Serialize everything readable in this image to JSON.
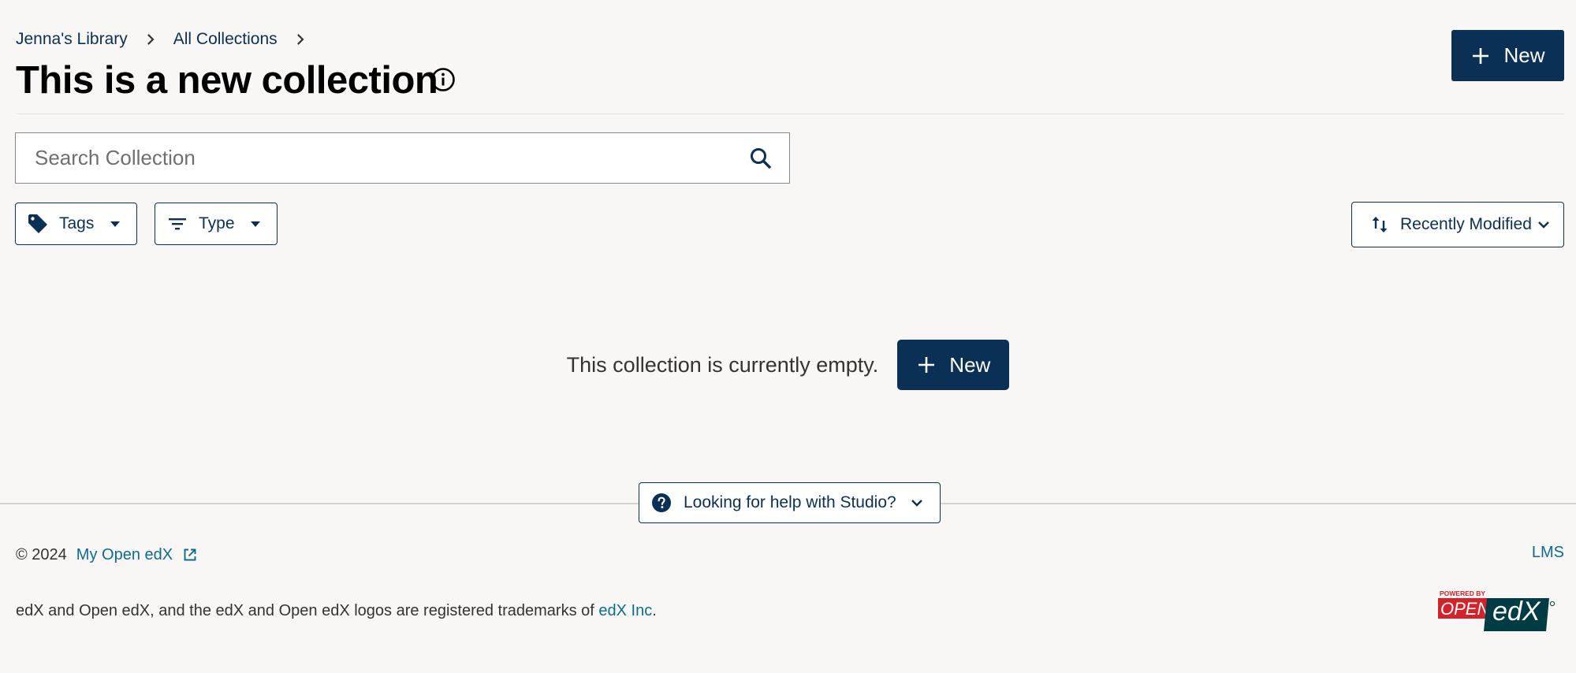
{
  "breadcrumb": {
    "items": [
      {
        "label": "Jenna's Library"
      },
      {
        "label": "All Collections"
      }
    ]
  },
  "header": {
    "title": "This is a new collection",
    "new_button_label": "New"
  },
  "search": {
    "placeholder": "Search Collection"
  },
  "filters": {
    "tags_label": "Tags",
    "type_label": "Type",
    "sort_label": "Recently Modified"
  },
  "empty_state": {
    "message": "This collection is currently empty.",
    "new_button_label": "New"
  },
  "help": {
    "label": "Looking for help with Studio?"
  },
  "footer": {
    "copyright": "© 2024",
    "my_open_edx": "My Open edX",
    "lms": "LMS",
    "trademark_text": "edX and Open edX, and the edX and Open edX logos are registered trademarks of ",
    "trademark_link": "edX Inc",
    "trademark_end": "."
  },
  "logo": {
    "powered_by": "POWERED BY",
    "open": "OPEN",
    "edx": "edX"
  },
  "colors": {
    "primary": "#0a3055",
    "link": "#0b6b93",
    "background": "#f8f7f6",
    "logo_red": "#d2232a"
  },
  "icons": {
    "breadcrumb_sep": "chevron-right-icon",
    "info": "info-icon",
    "add": "plus-icon",
    "search": "search-icon",
    "tags": "tag-icon",
    "type": "filter-list-icon",
    "sort": "swap-vert-icon",
    "help": "help-circle-icon",
    "external": "external-link-icon"
  }
}
